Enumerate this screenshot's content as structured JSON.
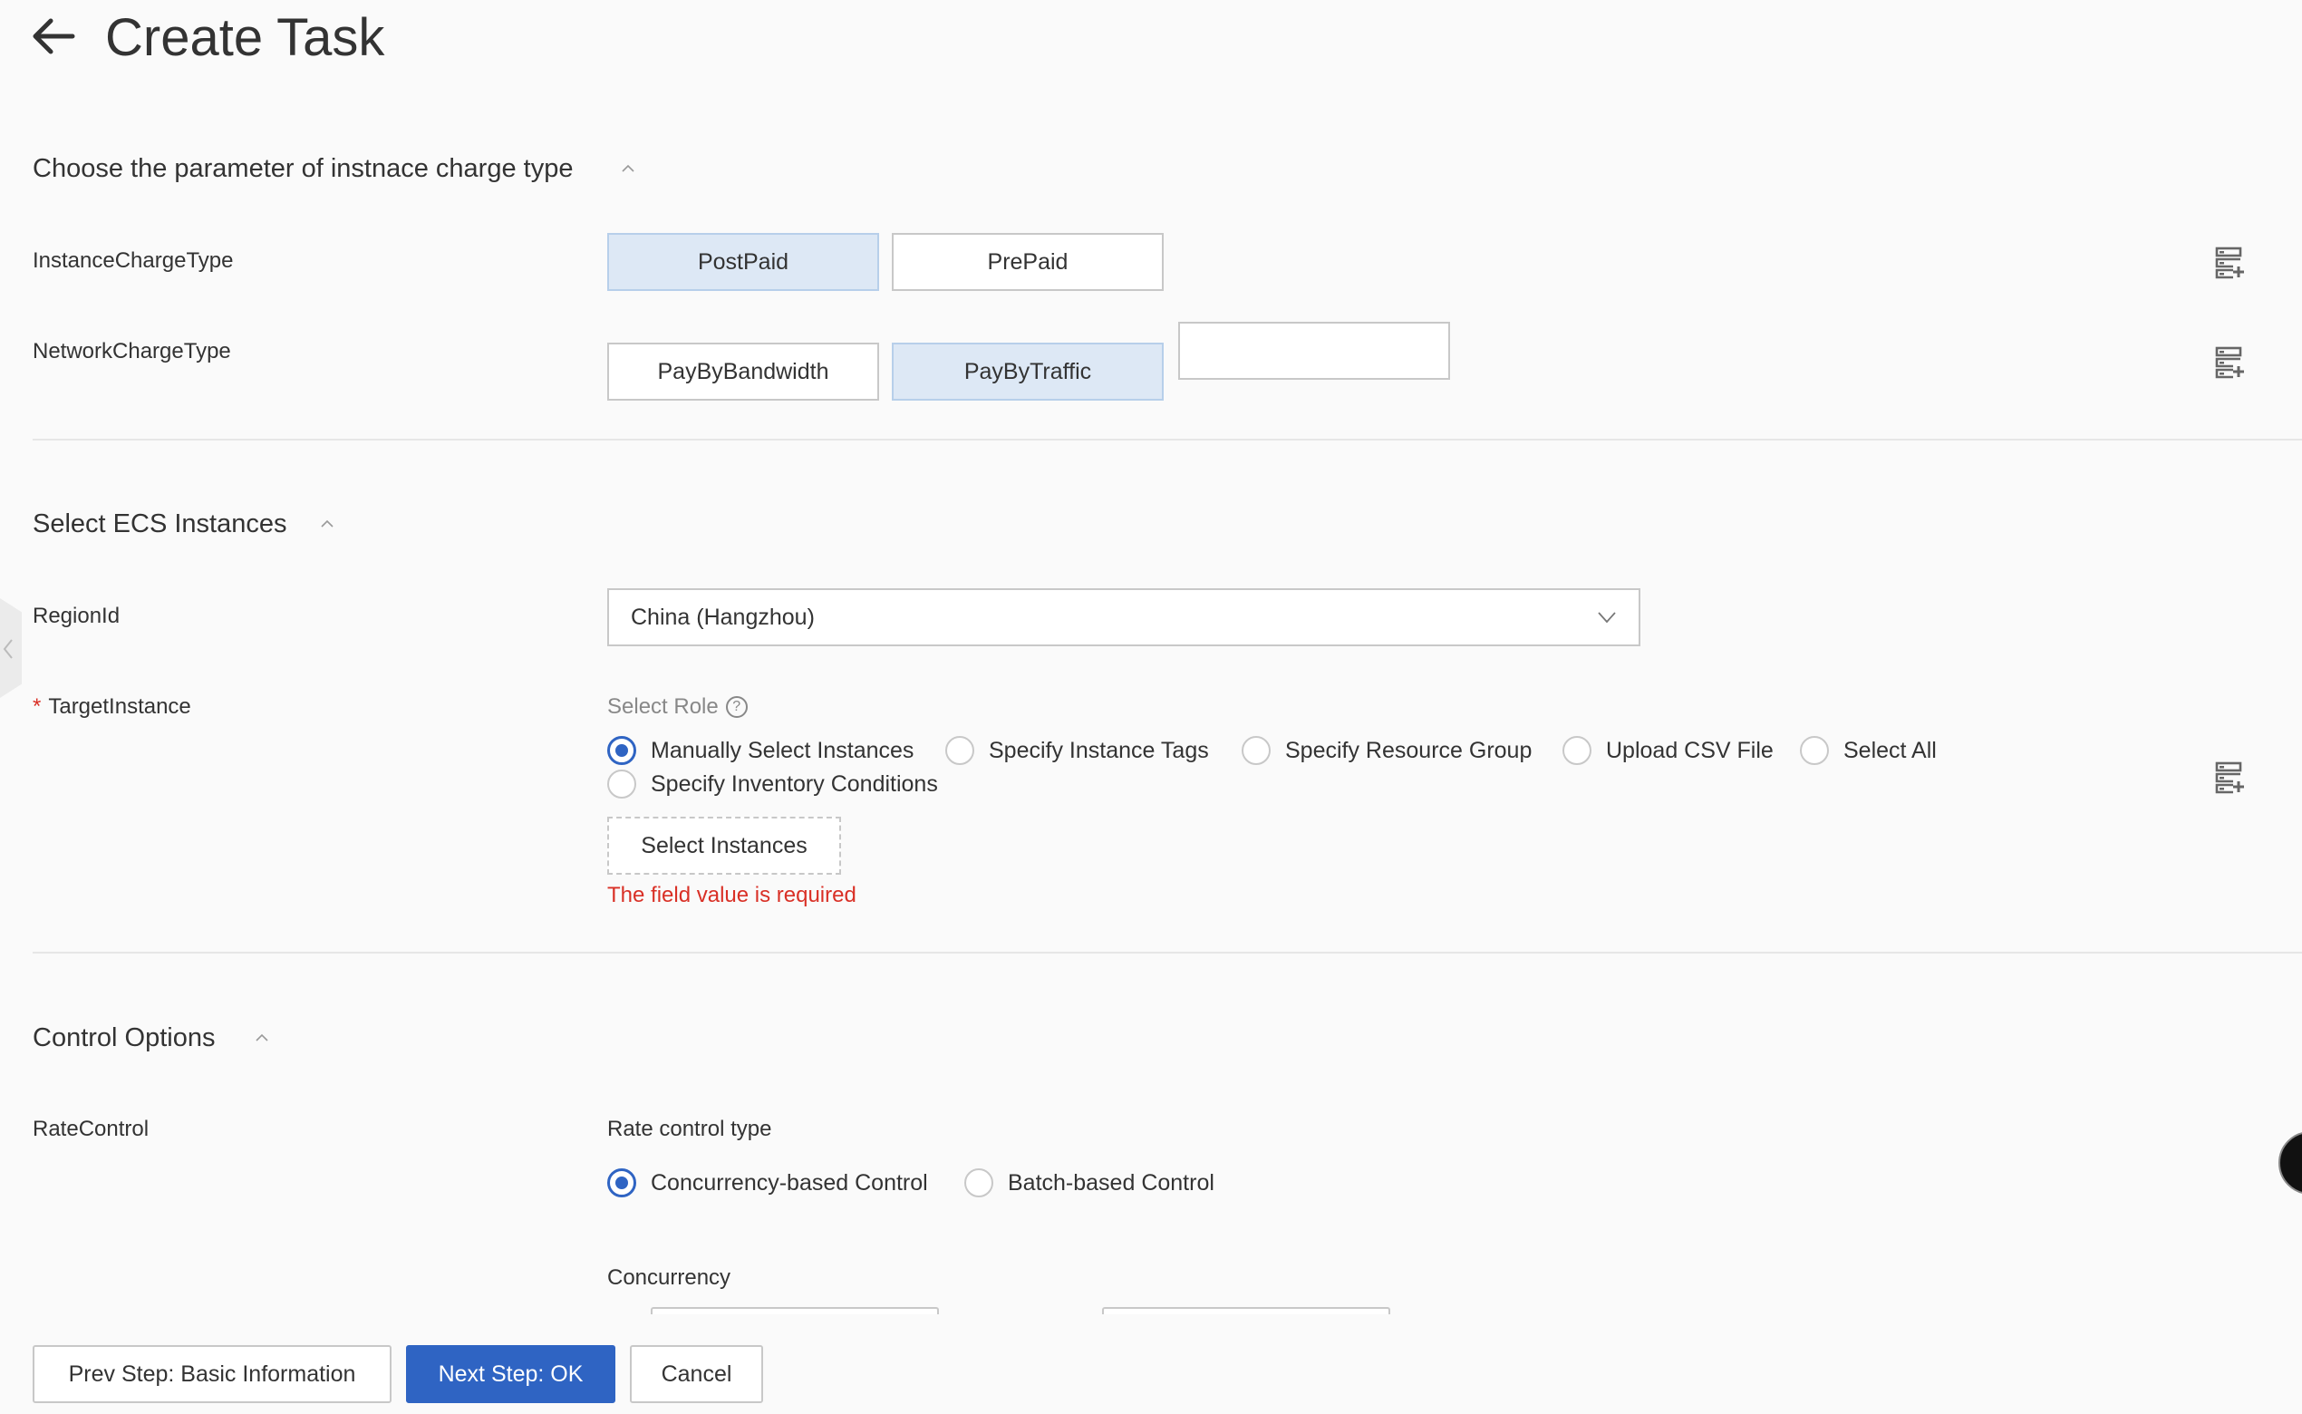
{
  "header": {
    "title": "Create Task",
    "back_icon": "arrow-left-icon"
  },
  "sections": {
    "charge": {
      "title": "Choose the parameter of instnace charge type",
      "instance_charge_type": {
        "label": "InstanceChargeType",
        "options": [
          "PostPaid",
          "PrePaid"
        ],
        "selected": "PostPaid"
      },
      "network_charge_type": {
        "label": "NetworkChargeType",
        "options": [
          "PayByBandwidth",
          "PayByTraffic"
        ],
        "selected": "PayByTraffic"
      }
    },
    "ecs": {
      "title": "Select ECS Instances",
      "region": {
        "label": "RegionId",
        "value": "China (Hangzhou)"
      },
      "target": {
        "label": "TargetInstance",
        "required_mark": "*",
        "role_label": "Select Role",
        "help_icon": "question-circle-icon",
        "options": [
          "Manually Select Instances",
          "Specify Instance Tags",
          "Specify Resource Group",
          "Upload CSV File",
          "Select All",
          "Specify Inventory Conditions"
        ],
        "selected": "Manually Select Instances",
        "select_button": "Select Instances",
        "error": "The field value is required"
      }
    },
    "control": {
      "title": "Control Options",
      "rate_control": {
        "label": "RateControl",
        "type_label": "Rate control type",
        "options": [
          "Concurrency-based Control",
          "Batch-based Control"
        ],
        "selected": "Concurrency-based Control",
        "concurrency_label": "Concurrency"
      }
    }
  },
  "footer": {
    "prev": "Prev Step: Basic Information",
    "next": "Next Step: OK",
    "cancel": "Cancel"
  },
  "colors": {
    "primary": "#2f64c3",
    "selected_bg": "#dde8f5",
    "error": "#d93026"
  }
}
